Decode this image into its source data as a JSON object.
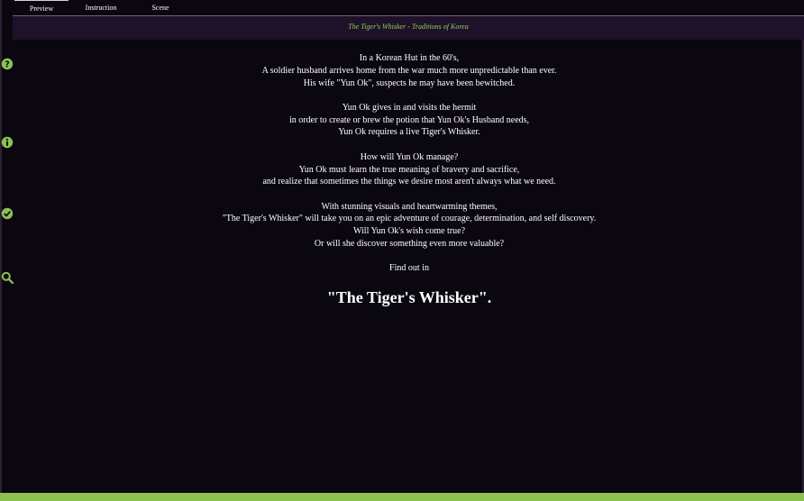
{
  "nav": {
    "tabs": [
      {
        "label": "Preview"
      },
      {
        "label": "Instruction"
      },
      {
        "label": "Scene"
      }
    ]
  },
  "header": {
    "title": "The Tiger's Whisker - Traditions of Korea"
  },
  "sidebar": {
    "icons": [
      "help-icon",
      "info-icon",
      "check-icon",
      "search-icon"
    ]
  },
  "story": {
    "p1": {
      "l1": "In a Korean Hut in the 60's,",
      "l2": "A soldier husband arrives home from the war much more unpredictable than ever.",
      "l3": "His wife \"Yun Ok\", suspects he may have been bewitched."
    },
    "p2": {
      "l1": "Yun Ok gives in and visits the hermit",
      "l2": "in order to create or brew the potion that Yun Ok's Husband needs,",
      "l3": "Yun Ok requires a live Tiger's Whisker."
    },
    "p3": {
      "l1": "How will Yun Ok manage?",
      "l2": "Yun Ok must learn the true meaning of bravery and sacrifice,",
      "l3": "and realize that sometimes the things we desire most aren't always what we need."
    },
    "p4": {
      "l1": "With stunning visuals and heartwarming themes,",
      "l2": "\"The Tiger's Whisker\" will take you on an epic adventure of courage, determination, and self discovery.",
      "l3": "Will Yun Ok's wish come true?",
      "l4": "Or will she discover something even more valuable?"
    },
    "p5": {
      "l1": "Find out in"
    },
    "finale": "\"The Tiger's Whisker\"."
  },
  "colors": {
    "background": "#0b0710",
    "title_bar": "#1e1129",
    "accent_green": "#8cc152",
    "title_text": "#8fd05c"
  }
}
